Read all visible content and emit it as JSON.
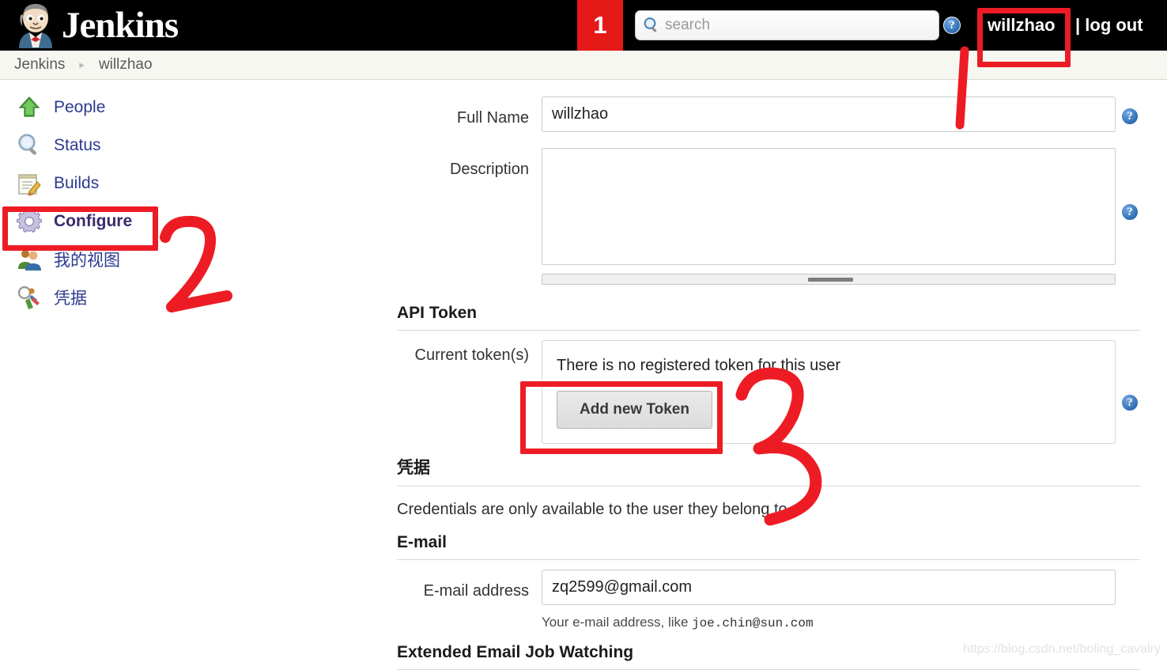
{
  "app": {
    "brand_title": "Jenkins",
    "logo_icon": "jenkins-butler-icon"
  },
  "header": {
    "annotation_badge": "1",
    "search": {
      "placeholder": "search",
      "value": "",
      "icon": "search-icon"
    },
    "help_icon": "help-icon",
    "user_label": "willzhao",
    "logout_label": "| log out"
  },
  "breadcrumb": {
    "root": "Jenkins",
    "separator": "▸",
    "current": "willzhao"
  },
  "sidebar": {
    "items": [
      {
        "label": "People",
        "icon": "green-up-arrow-icon",
        "active": false
      },
      {
        "label": "Status",
        "icon": "magnifier-icon",
        "active": false
      },
      {
        "label": "Builds",
        "icon": "notepad-pencil-icon",
        "active": false
      },
      {
        "label": "Configure",
        "icon": "gear-icon",
        "active": true
      },
      {
        "label": "我的视图",
        "icon": "people-icon",
        "active": false
      },
      {
        "label": "凭据",
        "icon": "key-person-icon",
        "active": false
      }
    ]
  },
  "main": {
    "full_name": {
      "label": "Full Name",
      "value": "willzhao",
      "help_icon": "help-icon"
    },
    "description": {
      "label": "Description",
      "value": "",
      "help_icon": "help-icon"
    },
    "api_token": {
      "heading": "API Token",
      "row_label": "Current token(s)",
      "empty_message": "There is no registered token for this user",
      "add_button_label": "Add new Token",
      "help_icon": "help-icon"
    },
    "credentials": {
      "heading": "凭据",
      "body": "Credentials are only available to the user they belong to"
    },
    "email": {
      "heading": "E-mail",
      "row_label": "E-mail address",
      "value": "zq2599@gmail.com",
      "hint_prefix": "Your e-mail address, like",
      "hint_example": "joe.chin@sun.com"
    },
    "extended_email": {
      "heading": "Extended Email Job Watching"
    }
  },
  "annotations": {
    "marker_1": "1",
    "marker_2": "2",
    "marker_3": "3",
    "highlight_color": "#ed1c24",
    "boxes": [
      "user-link-highlight",
      "configure-highlight",
      "add-new-token-highlight"
    ],
    "arrow": "arrow-pointing-to-user-link"
  },
  "watermark": {
    "text": "https://blog.csdn.net/boling_cavalry"
  }
}
